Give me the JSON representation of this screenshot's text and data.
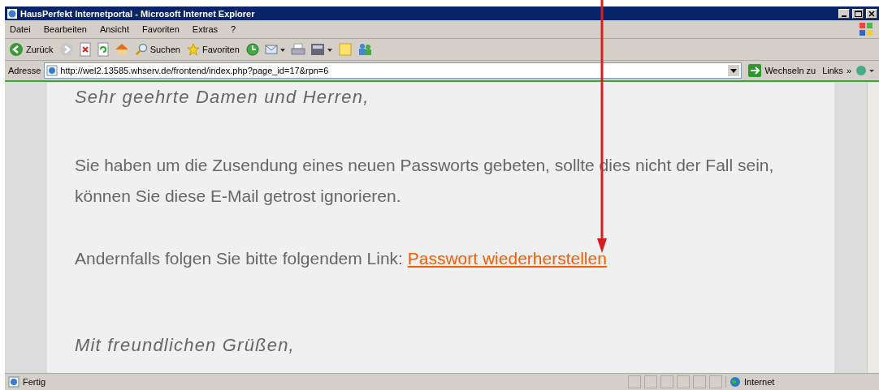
{
  "window": {
    "title": "HausPerfekt Internetportal - Microsoft Internet Explorer"
  },
  "menu": [
    "Datei",
    "Bearbeiten",
    "Ansicht",
    "Favoriten",
    "Extras",
    "?"
  ],
  "toolbar": [
    {
      "kind": "back",
      "label": "Zurück"
    },
    {
      "kind": "forward"
    },
    {
      "kind": "stop"
    },
    {
      "kind": "refresh"
    },
    {
      "kind": "home"
    },
    {
      "kind": "search",
      "label": "Suchen"
    },
    {
      "kind": "favorites",
      "label": "Favoriten"
    },
    {
      "kind": "history"
    },
    {
      "kind": "mail"
    },
    {
      "kind": "print"
    },
    {
      "kind": "edit"
    },
    {
      "kind": "note"
    },
    {
      "kind": "messenger"
    }
  ],
  "address": {
    "label": "Adresse",
    "value": "http://wel2.13585.whserv.de/frontend/index.php?page_id=17&rpn=6",
    "go": "Wechseln zu",
    "links": "Links",
    "more": "»"
  },
  "content": [
    {
      "kind": "greeting",
      "text": "Sehr geehrte Damen und Herren,"
    },
    {
      "kind": "paragraph",
      "text": "Sie haben um die Zusendung eines neuen Passworts gebeten, sollte dies nicht der Fall sein, können Sie diese E-Mail getrost ignorieren."
    },
    {
      "kind": "link_paragraph",
      "text": "Andernfalls folgen Sie bitte folgendem Link:",
      "link": "Passwort wiederherstellen"
    },
    {
      "kind": "greeting",
      "text": "Mit freundlichen Grüßen,"
    }
  ],
  "status_bar": {
    "text": "Fertig",
    "zone": "Internet"
  }
}
